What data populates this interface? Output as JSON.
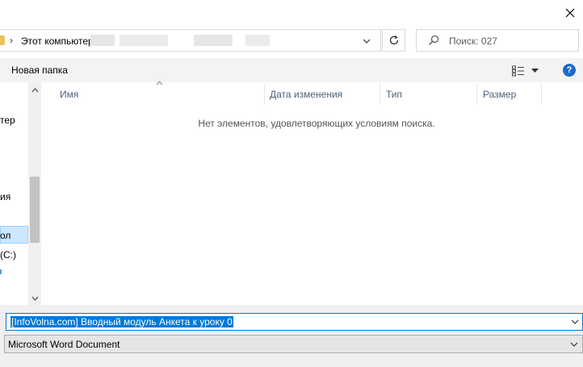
{
  "address": {
    "separator": "›",
    "path": "Этот компьютер"
  },
  "search": {
    "placeholder": "Поиск: 027"
  },
  "toolbar": {
    "new_folder_label": "Новая папка",
    "help_label": "?"
  },
  "nav": {
    "items": [
      {
        "label": "тер"
      },
      {
        "label": "ия"
      },
      {
        "label": "ол"
      },
      {
        "label": "(C:)"
      }
    ]
  },
  "columns": [
    "Имя",
    "Дата изменения",
    "Тип",
    "Размер"
  ],
  "empty_message": "Нет элементов, удовлетворяющих условиям поиска.",
  "save": {
    "filename": "[InfoVolna.com] Вводный модуль Анкета к уроку 0",
    "filetype": "Microsoft Word Document"
  },
  "colors": {
    "accent": "#0078d7",
    "selection": "#cce8ff",
    "help": "#1b6ac9"
  },
  "icons": [
    "close-icon",
    "folder-icon",
    "chevron-down-icon",
    "refresh-icon",
    "search-icon",
    "view-options-icon",
    "help-icon"
  ]
}
